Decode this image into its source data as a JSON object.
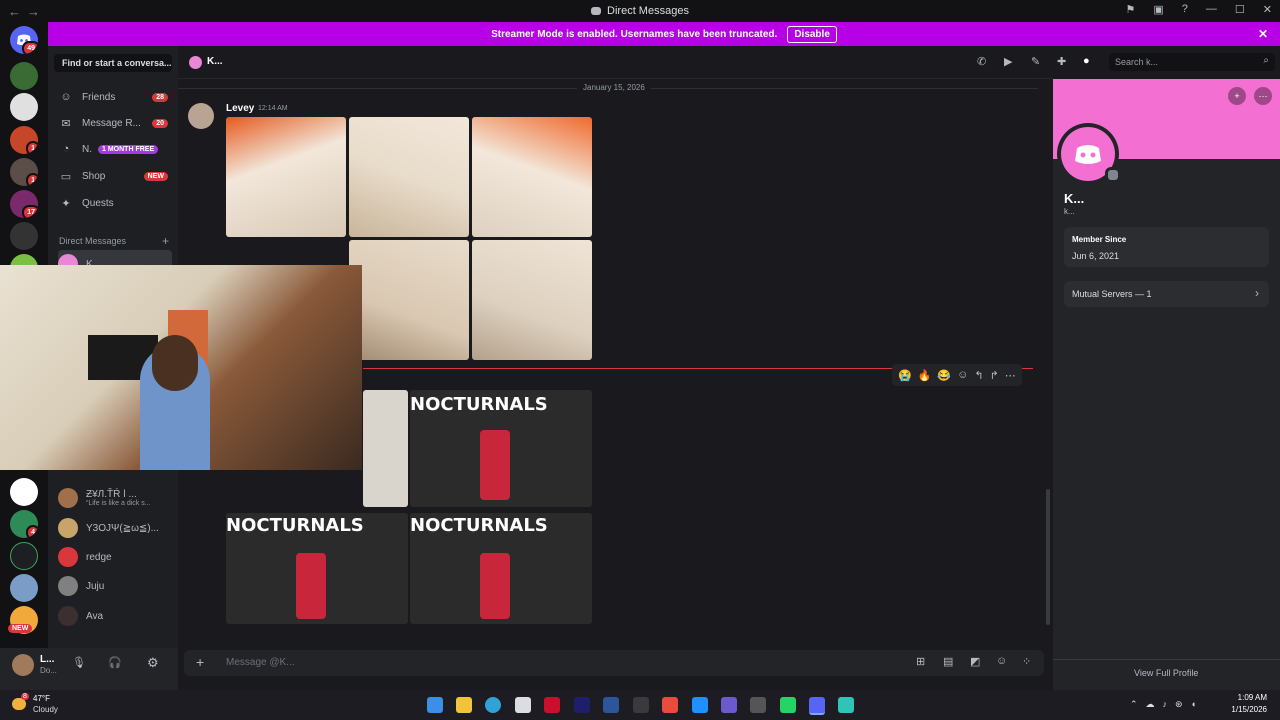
{
  "window": {
    "title": "Direct Messages"
  },
  "banner": {
    "text": "Streamer Mode is enabled. Usernames have been truncated.",
    "disable_label": "Disable"
  },
  "servers": {
    "home_badge": "49",
    "badges": [
      "1",
      "1",
      "17",
      "4"
    ],
    "new_label": "NEW"
  },
  "sidebar": {
    "find_placeholder": "Find or start a conversa...",
    "nav": [
      {
        "label": "Friends",
        "icon": "friends-icon",
        "badge": "28"
      },
      {
        "label": "Message R...",
        "icon": "message-requests-icon",
        "badge": "20"
      },
      {
        "label": "N.",
        "icon": "nitro-icon",
        "badge": "1 MONTH FREE"
      },
      {
        "label": "Shop",
        "icon": "shop-icon",
        "badge": "NEW"
      },
      {
        "label": "Quests",
        "icon": "quests-icon",
        "badge": ""
      }
    ],
    "dm_header": "Direct Messages",
    "dms": [
      {
        "name": "K...",
        "sub": "",
        "color": "#e887d6"
      },
      {
        "name": "Ƶ¥Л.ŤŔ ǀ ...",
        "sub": "“Life is like a dick s...",
        "color": "#a0704b"
      },
      {
        "name": "Y3OJΨ(≧ω≦)...",
        "sub": "",
        "color": "#c8a46b"
      },
      {
        "name": "redge",
        "sub": "",
        "color": "#da373c"
      },
      {
        "name": "Juju",
        "sub": "",
        "color": "#808080"
      },
      {
        "name": "Ava",
        "sub": "",
        "color": "#3b2f2f"
      }
    ]
  },
  "user": {
    "name": "L...",
    "status": "Do..."
  },
  "chat": {
    "recipient": "K...",
    "search_placeholder": "Search k...",
    "date_divider": "January 15, 2026",
    "message": {
      "author": "Levey",
      "time": "12:14 AM"
    },
    "reactions": [
      "😭",
      "🔥",
      "😂"
    ],
    "gif_caption": "NOCTURNALS",
    "composer_placeholder": "Message @K..."
  },
  "profile": {
    "name": "K...",
    "handle": "k...",
    "member_since_label": "Member Since",
    "member_since": "Jun 6, 2021",
    "mutual_servers": "Mutual Servers — 1",
    "view_full": "View Full Profile"
  },
  "taskbar": {
    "weather_temp": "47°F",
    "weather_desc": "Cloudy",
    "weather_badge": "8",
    "time": "1:09 AM",
    "date": "1/15/2026"
  },
  "colors": {
    "accent": "#b700e6",
    "discord": "#5865f2",
    "profile_banner": "#f36fd1",
    "danger": "#da373c"
  }
}
